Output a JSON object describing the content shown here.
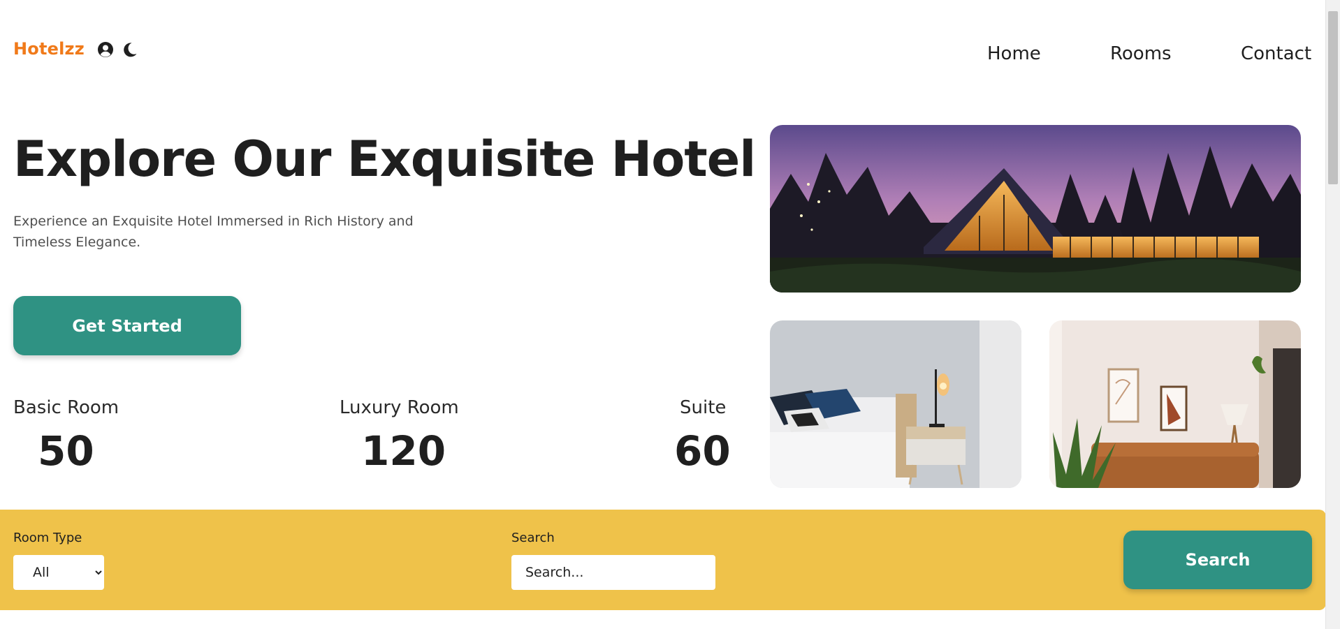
{
  "brand": {
    "name": "Hotelzz",
    "color": "#f07a1a"
  },
  "header": {
    "icons": [
      "user-circle-icon",
      "moon-icon"
    ],
    "nav": [
      {
        "label": "Home"
      },
      {
        "label": "Rooms"
      },
      {
        "label": "Contact"
      }
    ]
  },
  "hero": {
    "title": "Explore Our Exquisite Hotel",
    "subtitle": "Experience an Exquisite Hotel Immersed in Rich History and Timeless Elegance.",
    "cta_label": "Get Started"
  },
  "stats": [
    {
      "label": "Basic Room",
      "value": "50"
    },
    {
      "label": "Luxury Room",
      "value": "120"
    },
    {
      "label": "Suite",
      "value": "60"
    }
  ],
  "gallery": [
    "hotel-exterior-dusk-image",
    "bedroom-image",
    "living-room-image"
  ],
  "search": {
    "room_type_label": "Room Type",
    "room_type_value": "All",
    "search_label": "Search",
    "search_placeholder": "Search...",
    "button_label": "Search"
  },
  "colors": {
    "accent": "#2f9283",
    "search_bar": "#efc24a",
    "brand": "#f07a1a"
  }
}
